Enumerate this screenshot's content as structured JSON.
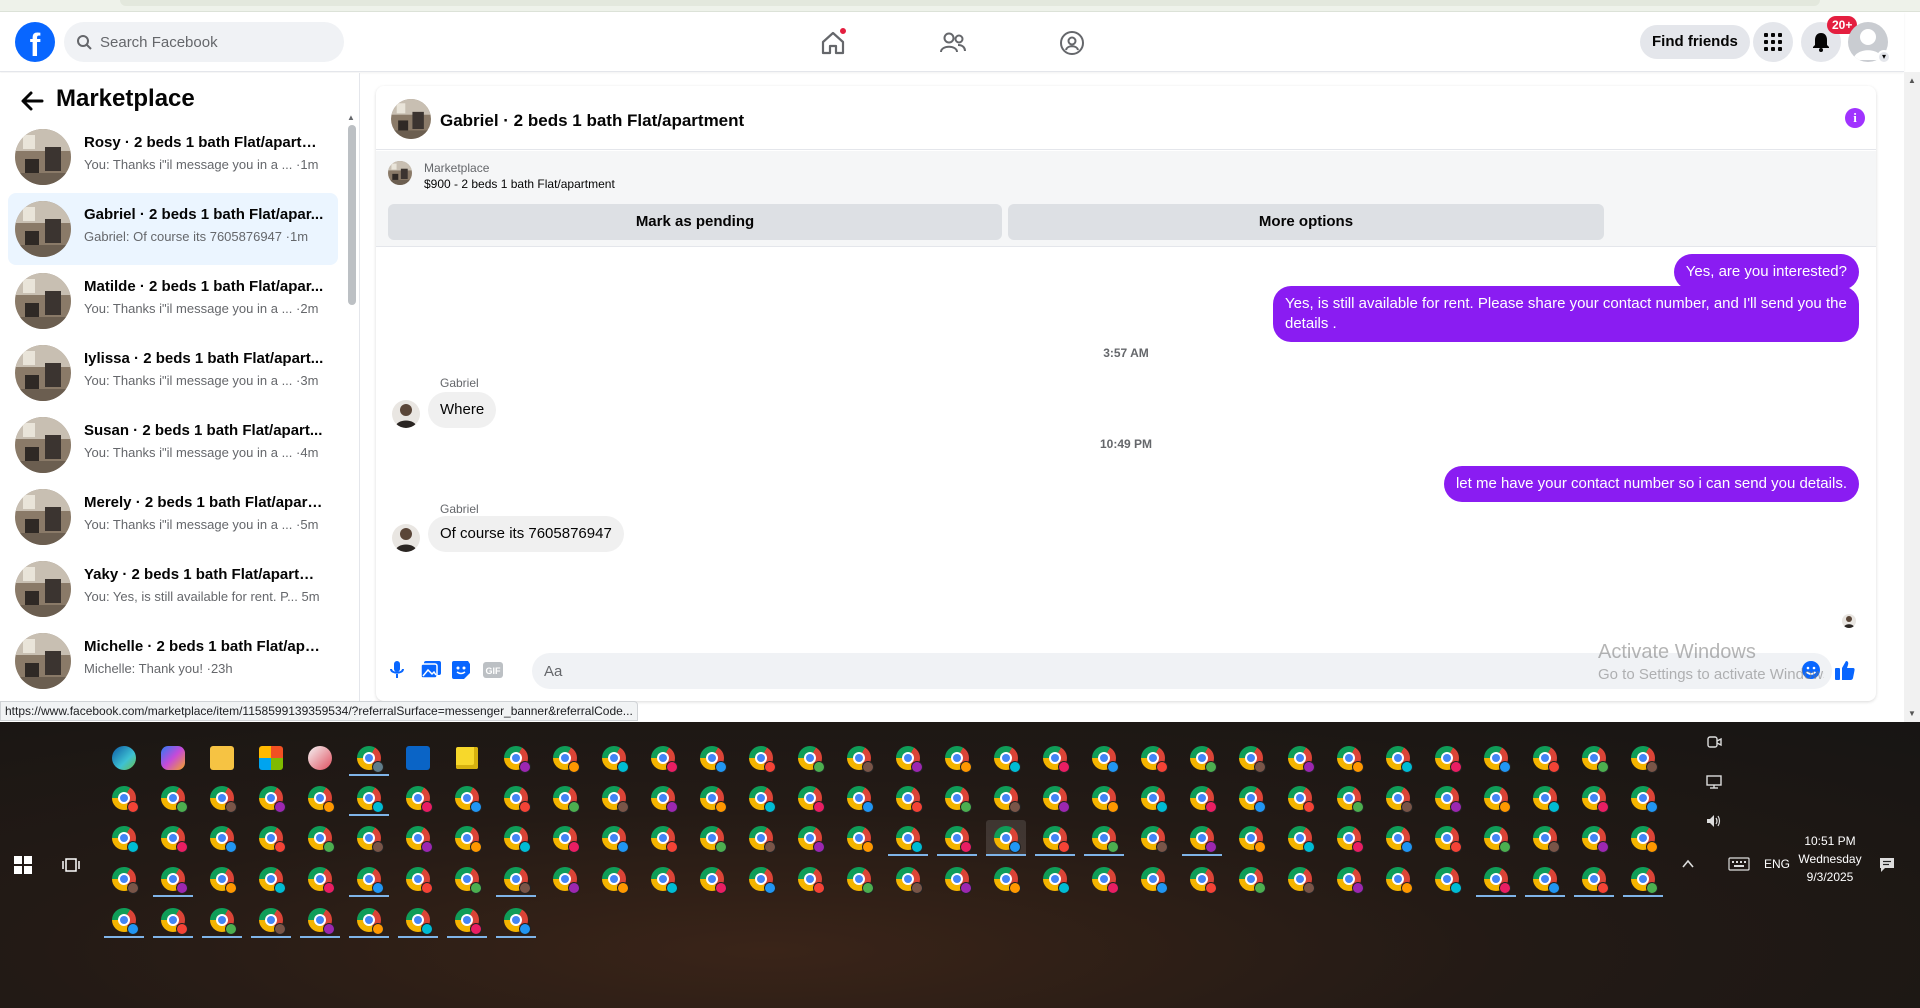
{
  "search": {
    "placeholder": "Search Facebook"
  },
  "header": {
    "find_friends": "Find friends",
    "notif_count": "20+"
  },
  "sidebar": {
    "title": "Marketplace",
    "conversations": [
      {
        "title": "Rosy · 2 beds 1 bath Flat/apartm...",
        "preview": "You: Thanks i\"il message you in a ...",
        "time": "·1m"
      },
      {
        "title": "Gabriel · 2 beds 1 bath Flat/apar...",
        "preview": "Gabriel: Of course its 7605876947",
        "time": "·1m"
      },
      {
        "title": "Matilde · 2 beds 1 bath Flat/apar...",
        "preview": "You: Thanks i\"il message you in a ...",
        "time": "·2m"
      },
      {
        "title": "Iylissa · 2 beds 1 bath Flat/apart...",
        "preview": "You: Thanks i\"il message you in a ...",
        "time": "·3m"
      },
      {
        "title": "Susan · 2 beds 1 bath Flat/apart...",
        "preview": "You: Thanks i\"il message you in a ...",
        "time": "·4m"
      },
      {
        "title": "Merely · 2 beds 1 bath Flat/apart...",
        "preview": "You: Thanks i\"il message you in a ...",
        "time": "·5m"
      },
      {
        "title": "Yaky · 2 beds 1 bath Flat/apartm...",
        "preview": "You: Yes, is still available for rent. P...",
        "time": "5m"
      },
      {
        "title": "Michelle · 2 beds 1 bath Flat/apa...",
        "preview": "Michelle: Thank you!",
        "time": "·23h"
      }
    ]
  },
  "chat": {
    "title": "Gabriel · 2 beds 1 bath Flat/apartment",
    "listing_label": "Marketplace",
    "listing_price": "$900 - 2 beds 1 bath Flat/apartment",
    "mark_pending": "Mark as pending",
    "more_options": "More options",
    "messages": {
      "out1": "Yes, are you interested?",
      "out2": "Yes, is still available for rent. Please share your contact number, and I'll send you the details .",
      "ts1": "3:57 AM",
      "in1_sender": "Gabriel",
      "in1": "Where",
      "ts2": "10:49 PM",
      "out3": "let me have your contact number so i can send you details.",
      "in2_sender": "Gabriel",
      "in2": "Of course its 7605876947"
    },
    "composer_placeholder": "Aa"
  },
  "watermark": {
    "title": "Activate Windows",
    "sub": "Go to Settings to activate Windows."
  },
  "status_url": "https://www.facebook.com/marketplace/item/1158599139359534/?referralSurface=messenger_banner&referralCode...",
  "taskbar": {
    "time": "10:51 PM",
    "day": "Wednesday",
    "date": "9/3/2025",
    "lang": "ENG"
  },
  "colors": {
    "fb_blue": "#0866ff",
    "bubble_out": "#8a1cf2",
    "notif_red": "#e41e3f"
  }
}
